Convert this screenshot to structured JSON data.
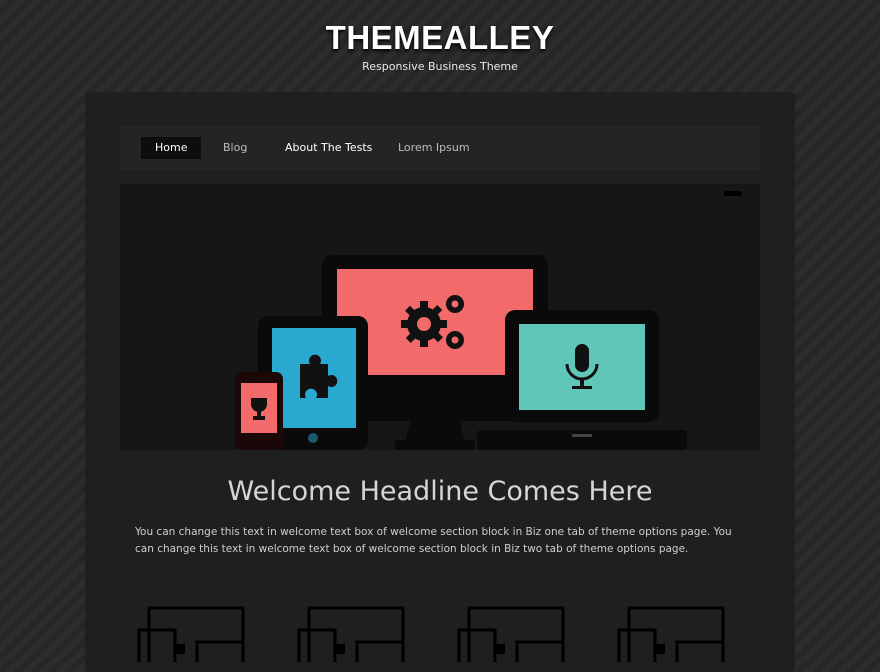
{
  "site": {
    "title": "THEMEALLEY",
    "tagline": "Responsive Business Theme"
  },
  "nav": {
    "items": [
      {
        "label": "Home",
        "active": true
      },
      {
        "label": "Blog",
        "active": false
      },
      {
        "label": "About The Tests",
        "active": false
      },
      {
        "label": "Lorem Ipsum",
        "active": false
      }
    ]
  },
  "slider": {
    "illustration": [
      "monitor-gears-icon",
      "tablet-puzzle-icon",
      "phone-trophy-icon",
      "laptop-microphone-icon"
    ],
    "colors": {
      "monitor": "#f26a6a",
      "tablet": "#29a9d0",
      "phone": "#f26a6a",
      "laptop": "#5fc6b8"
    }
  },
  "welcome": {
    "headline": "Welcome Headline Comes Here",
    "text": "You can change this text in welcome text box of welcome section block in Biz one tab of theme options page. You can change this text in welcome text box of welcome section block in Biz two tab of theme options page."
  },
  "features": {
    "icons": [
      "devices-outline-icon",
      "devices-outline-icon",
      "devices-outline-icon",
      "devices-outline-icon"
    ]
  }
}
